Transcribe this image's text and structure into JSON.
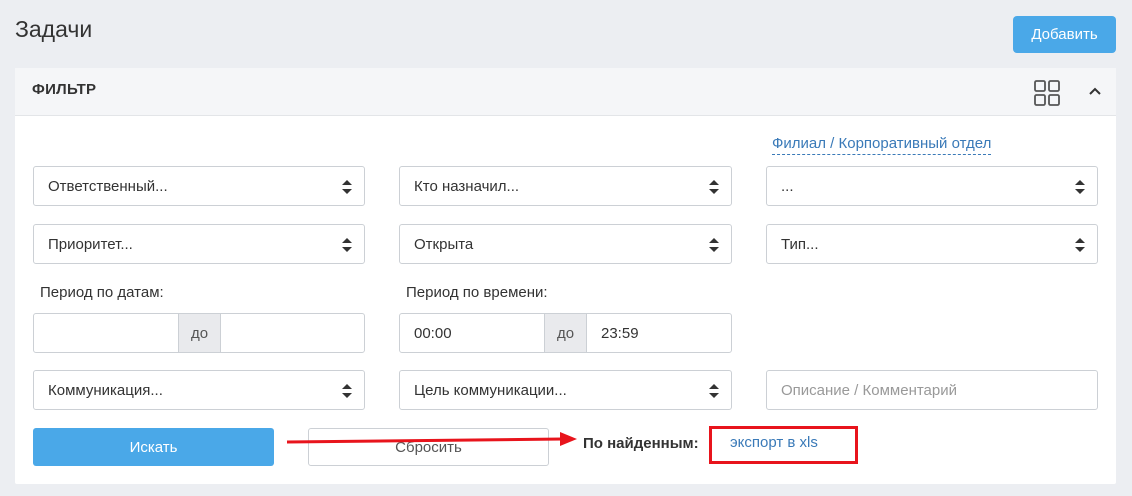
{
  "header": {
    "title": "Задачи",
    "add_label": "Добавить"
  },
  "filter": {
    "title": "ФИЛЬТР",
    "dept_link": "Филиал / Корпоративный отдел",
    "responsible": "Ответственный...",
    "assigned_by": "Кто назначил...",
    "dept": "...",
    "priority": "Приоритет...",
    "status": "Открыта",
    "type": "Тип...",
    "date_period_label": "Период по датам:",
    "date_from": "",
    "date_sep": "до",
    "date_to": "",
    "time_period_label": "Период по времени:",
    "time_from": "00:00",
    "time_sep": "до",
    "time_to": "23:59",
    "communication": "Коммуникация...",
    "communication_goal": "Цель коммуникации...",
    "description_placeholder": "Описание / Комментарий",
    "search_label": "Искать",
    "reset_label": "Сбросить",
    "found_label": "По найденным:",
    "export_label": "экспорт в xls"
  },
  "colors": {
    "accent": "#4aa8e8",
    "link": "#3a7ab8",
    "annotation": "#e8141c"
  }
}
